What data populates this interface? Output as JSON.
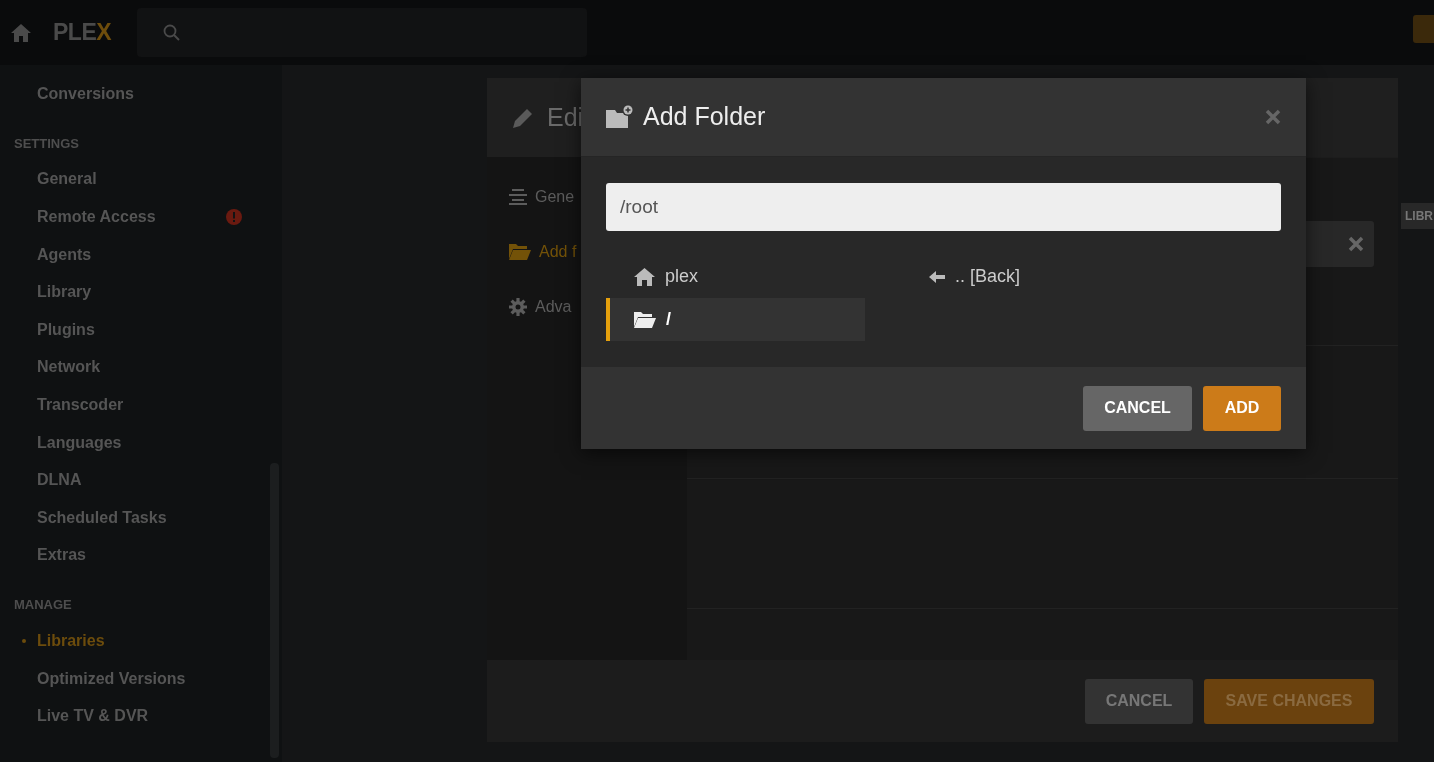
{
  "topbar": {
    "logo": "PLEX"
  },
  "sidebar": {
    "items": [
      {
        "kind": "link",
        "label": "Conversions",
        "selected": false,
        "alert": false
      },
      {
        "kind": "heading",
        "label": "SETTINGS"
      },
      {
        "kind": "link",
        "label": "General",
        "selected": false,
        "alert": false
      },
      {
        "kind": "link",
        "label": "Remote Access",
        "selected": false,
        "alert": true
      },
      {
        "kind": "link",
        "label": "Agents",
        "selected": false,
        "alert": false
      },
      {
        "kind": "link",
        "label": "Library",
        "selected": false,
        "alert": false
      },
      {
        "kind": "link",
        "label": "Plugins",
        "selected": false,
        "alert": false
      },
      {
        "kind": "link",
        "label": "Network",
        "selected": false,
        "alert": false
      },
      {
        "kind": "link",
        "label": "Transcoder",
        "selected": false,
        "alert": false
      },
      {
        "kind": "link",
        "label": "Languages",
        "selected": false,
        "alert": false
      },
      {
        "kind": "link",
        "label": "DLNA",
        "selected": false,
        "alert": false
      },
      {
        "kind": "link",
        "label": "Scheduled Tasks",
        "selected": false,
        "alert": false
      },
      {
        "kind": "link",
        "label": "Extras",
        "selected": false,
        "alert": false
      },
      {
        "kind": "heading",
        "label": "MANAGE"
      },
      {
        "kind": "link",
        "label": "Libraries",
        "selected": true,
        "alert": false
      },
      {
        "kind": "link",
        "label": "Optimized Versions",
        "selected": false,
        "alert": false
      },
      {
        "kind": "link",
        "label": "Live TV & DVR",
        "selected": false,
        "alert": false
      }
    ]
  },
  "page": {
    "tag": "LIBR"
  },
  "edit_modal": {
    "title": "Edi",
    "nav": [
      {
        "label": "Gene",
        "selected": false
      },
      {
        "label": "Add f",
        "selected": true
      },
      {
        "label": "Adva",
        "selected": false
      }
    ],
    "folder_field": {
      "clearable": true
    },
    "buttons": [
      {
        "kind": "secondary",
        "label": "CANCEL"
      },
      {
        "kind": "primary",
        "label": "SAVE CHANGES"
      }
    ]
  },
  "add_folder_modal": {
    "title": "Add Folder",
    "path": "/root",
    "entries": [
      {
        "label": "plex",
        "selected": false
      },
      {
        "label": "/",
        "selected": true
      },
      {
        "label": ".. [Back]",
        "selected": false
      }
    ],
    "buttons": [
      {
        "kind": "secondary",
        "label": "CANCEL"
      },
      {
        "kind": "primary",
        "label": "ADD"
      }
    ]
  }
}
